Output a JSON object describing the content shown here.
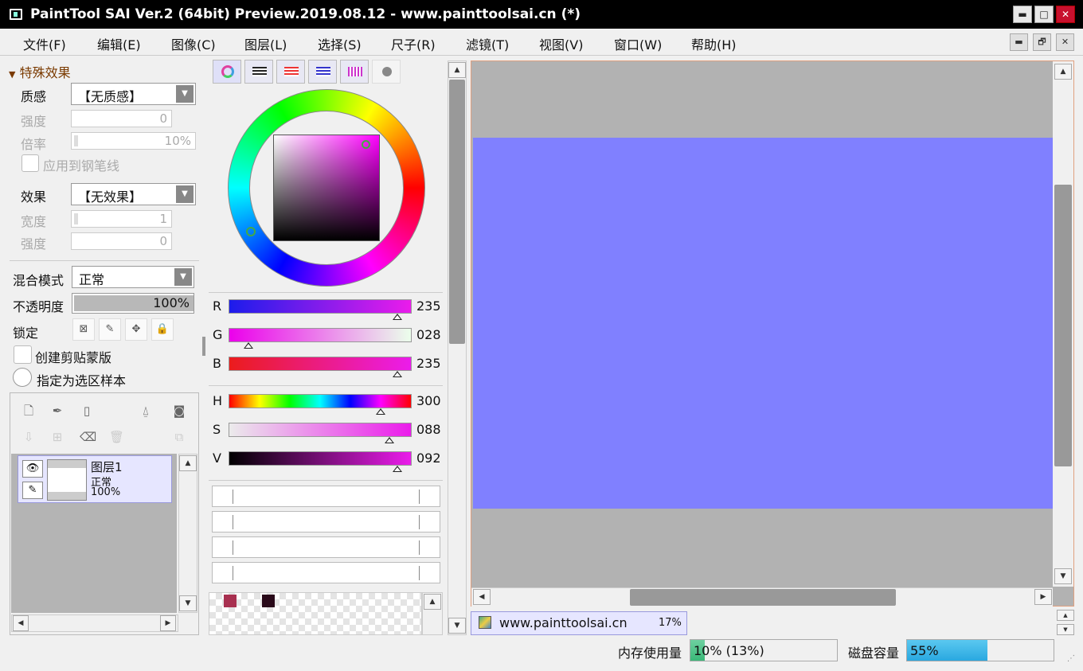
{
  "window": {
    "title": "PaintTool SAI Ver.2 (64bit) Preview.2019.08.12 - www.painttoolsai.cn (*)",
    "buttons": {
      "minimize": "▬",
      "maximize": "□",
      "close": "✕"
    }
  },
  "menu": {
    "items": [
      "文件(F)",
      "编辑(E)",
      "图像(C)",
      "图层(L)",
      "选择(S)",
      "尺子(R)",
      "滤镜(T)",
      "视图(V)",
      "窗口(W)",
      "帮助(H)"
    ],
    "mdi_buttons": [
      "▬",
      "🗗",
      "✕"
    ]
  },
  "effects": {
    "section_title": "特殊效果",
    "texture_label": "质感",
    "texture_value": "【无质感】",
    "strength_label": "强度",
    "strength_value": "0",
    "scale_label": "倍率",
    "scale_value": "10%",
    "apply_pen_label": "应用到钢笔线",
    "effect_label": "效果",
    "effect_value": "【无效果】",
    "width_label": "宽度",
    "width_value": "1",
    "effect_strength_label": "强度",
    "effect_strength_value": "0"
  },
  "layer_props": {
    "blend_label": "混合模式",
    "blend_value": "正常",
    "opacity_label": "不透明度",
    "opacity_value": "100%",
    "opacity_fraction": 1.0,
    "lock_label": "锁定",
    "clip_label": "创建剪贴蒙版",
    "sample_label": "指定为选区样本"
  },
  "layers": [
    {
      "name": "图层1",
      "mode": "正常",
      "opacity": "100%"
    }
  ],
  "color": {
    "current_hex": "#eb1ceb",
    "sliders": [
      {
        "id": "r",
        "label": "R",
        "value": "235",
        "fraction": 0.92,
        "gradient": "linear-gradient(to right,#1c1ceb,#eb1ceb)"
      },
      {
        "id": "g",
        "label": "G",
        "value": "028",
        "fraction": 0.11,
        "gradient": "linear-gradient(to right,#eb00eb,#ebffeb)"
      },
      {
        "id": "b",
        "label": "B",
        "value": "235",
        "fraction": 0.92,
        "gradient": "linear-gradient(to right,#eb1c1c,#eb1ceb)"
      },
      {
        "id": "h",
        "label": "H",
        "value": "300",
        "fraction": 0.83,
        "gradient": "linear-gradient(to right,#f00,#ff0,#0f0,#0ff,#00f,#f0f,#f00)"
      },
      {
        "id": "s",
        "label": "S",
        "value": "088",
        "fraction": 0.88,
        "gradient": "linear-gradient(to right,#ebebeb,#eb1ceb)"
      },
      {
        "id": "v",
        "label": "V",
        "value": "092",
        "fraction": 0.92,
        "gradient": "linear-gradient(to right,#000,#eb1ceb)"
      }
    ],
    "swatches": [
      "#a83050",
      "#2a0a1a"
    ]
  },
  "document": {
    "tab_name": "www.painttoolsai.cn",
    "zoom": "17%",
    "canvas_color": "#8080ff"
  },
  "status": {
    "memory_label": "内存使用量",
    "memory_value": "10% (13%)",
    "memory_fraction": 0.1,
    "disk_label": "磁盘容量",
    "disk_value": "55%",
    "disk_fraction": 0.55
  }
}
